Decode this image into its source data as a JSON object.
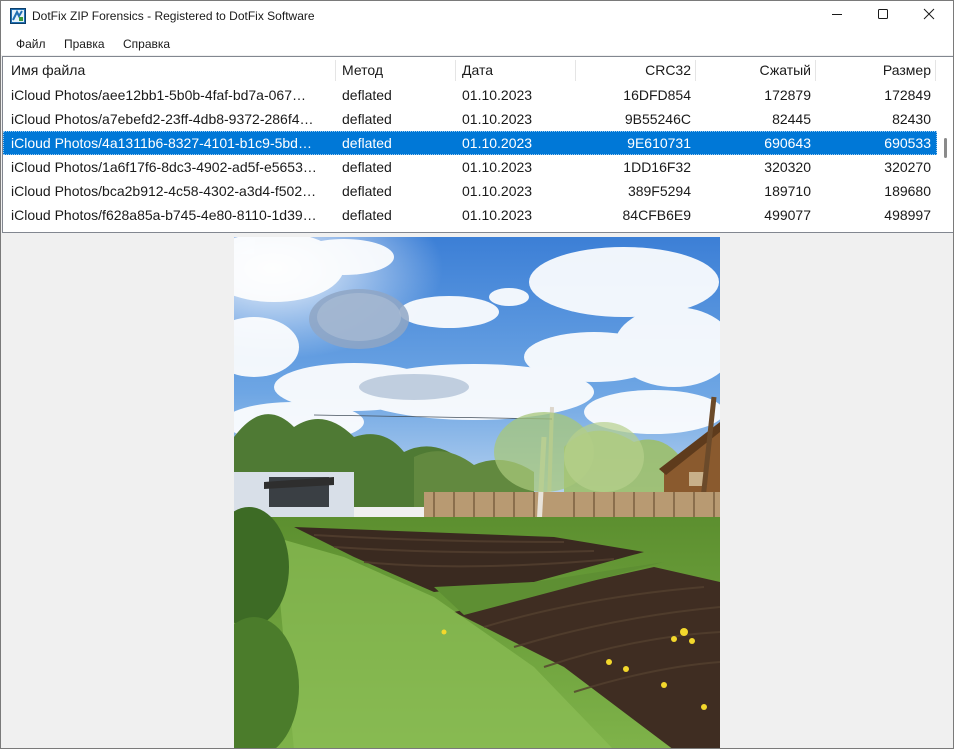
{
  "window": {
    "title": "DotFix ZIP Forensics - Registered to DotFix Software",
    "icons": {
      "app": "app-logo-icon",
      "minimize": "minimize-icon",
      "maximize": "maximize-icon",
      "close": "close-icon"
    }
  },
  "menu": {
    "items": [
      {
        "label": "Файл"
      },
      {
        "label": "Правка"
      },
      {
        "label": "Справка"
      }
    ]
  },
  "list": {
    "columns": [
      {
        "label": "Имя файла"
      },
      {
        "label": "Метод"
      },
      {
        "label": "Дата"
      },
      {
        "label": "CRC32"
      },
      {
        "label": "Сжатый"
      },
      {
        "label": "Размер"
      }
    ],
    "rows": [
      {
        "name": "iCloud Photos/aee12bb1-5b0b-4faf-bd7a-067…",
        "method": "deflated",
        "date": "01.10.2023",
        "crc": "16DFD854",
        "packed": "172879",
        "size": "172849",
        "selected": false
      },
      {
        "name": "iCloud Photos/a7ebefd2-23ff-4db8-9372-286f4…",
        "method": "deflated",
        "date": "01.10.2023",
        "crc": "9B55246C",
        "packed": "82445",
        "size": "82430",
        "selected": false
      },
      {
        "name": "iCloud Photos/4a1311b6-8327-4101-b1c9-5bd…",
        "method": "deflated",
        "date": "01.10.2023",
        "crc": "9E610731",
        "packed": "690643",
        "size": "690533",
        "selected": true
      },
      {
        "name": "iCloud Photos/1a6f17f6-8dc3-4902-ad5f-e5653…",
        "method": "deflated",
        "date": "01.10.2023",
        "crc": "1DD16F32",
        "packed": "320320",
        "size": "320270",
        "selected": false
      },
      {
        "name": "iCloud Photos/bca2b912-4c58-4302-a3d4-f502…",
        "method": "deflated",
        "date": "01.10.2023",
        "crc": "389F5294",
        "packed": "189710",
        "size": "189680",
        "selected": false
      },
      {
        "name": "iCloud Photos/f628a85a-b745-4e80-8110-1d39…",
        "method": "deflated",
        "date": "01.10.2023",
        "crc": "84CFB6E9",
        "packed": "499077",
        "size": "498997",
        "selected": false
      }
    ],
    "selected_color": "#0078d7"
  },
  "preview": {
    "subject": "garden-photo"
  }
}
